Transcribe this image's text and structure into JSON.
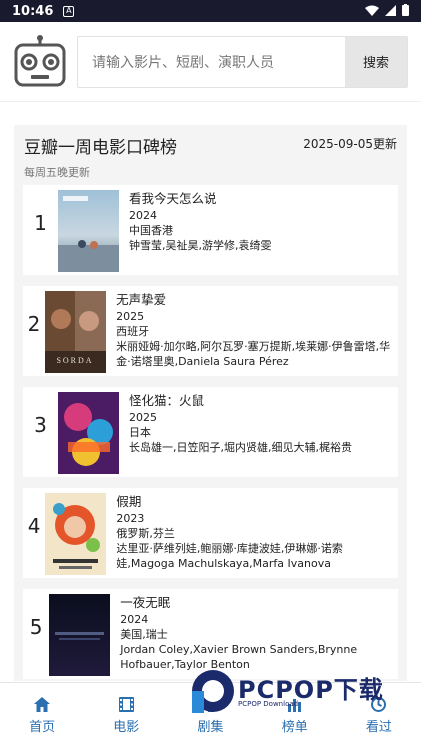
{
  "status": {
    "time": "10:46",
    "notif": "A"
  },
  "search": {
    "placeholder": "请输入影片、短剧、演职人员",
    "button": "搜索"
  },
  "panel": {
    "title": "豆瓣一周电影口碑榜",
    "date": "2025-09-05更新",
    "subtitle": "每周五晚更新"
  },
  "movies": [
    {
      "rank": "1",
      "title": "看我今天怎么说",
      "year": "2024",
      "region": "中国香港",
      "cast": "钟雪莹,吴祉昊,游学修,袁绮雯"
    },
    {
      "rank": "2",
      "title": "无声挚爱",
      "year": "2025",
      "region": "西班牙",
      "cast": "米丽娅姆·加尔略,阿尔瓦罗·塞万提斯,埃莱娜·伊鲁雷塔,华金·诺塔里奥,Daniela Saura Pérez",
      "poster_text": "SORDA"
    },
    {
      "rank": "3",
      "title": "怪化猫：火鼠",
      "year": "2025",
      "region": "日本",
      "cast": "长岛雄一,日笠阳子,堀内贤雄,细见大辅,梶裕贵"
    },
    {
      "rank": "4",
      "title": "假期",
      "year": "2023",
      "region": "俄罗斯,芬兰",
      "cast": "达里亚·萨维列娃,鲍丽娜·库捷波娃,伊琳娜·诺索娃,Magoga Machulskaya,Marfa Ivanova"
    },
    {
      "rank": "5",
      "title": "一夜无眠",
      "year": "2024",
      "region": "美国,瑞士",
      "cast": "Jordan Coley,Xavier Brown Sanders,Brynne Hofbauer,Taylor Benton"
    }
  ],
  "nav": [
    {
      "label": "首页",
      "icon": "home-icon"
    },
    {
      "label": "电影",
      "icon": "film-icon"
    },
    {
      "label": "剧集",
      "icon": "tv-icon"
    },
    {
      "label": "榜单",
      "icon": "chart-icon"
    },
    {
      "label": "看过",
      "icon": "history-icon"
    }
  ],
  "watermark": {
    "text": "PCPOP下载",
    "sub": "PCPOP Download"
  },
  "colors": {
    "accent": "#2a6fb0",
    "status_bar": "#1a1a2e",
    "panel_bg": "#f4f4f4"
  }
}
